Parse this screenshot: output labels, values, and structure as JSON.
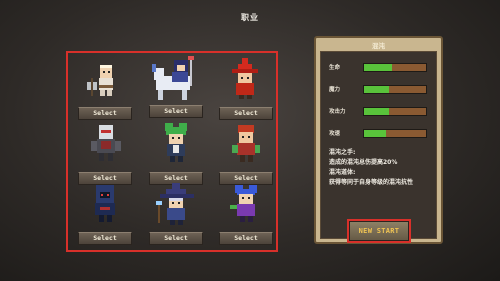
{
  "screen": {
    "title": "职业"
  },
  "characters": [
    {
      "name": "warrior",
      "select_label": "Select"
    },
    {
      "name": "knight-rider",
      "select_label": "Select"
    },
    {
      "name": "red-witch",
      "select_label": "Select"
    },
    {
      "name": "robot",
      "select_label": "Select"
    },
    {
      "name": "green-hair",
      "select_label": "Select"
    },
    {
      "name": "red-hair",
      "select_label": "Select"
    },
    {
      "name": "hooded-ninja",
      "select_label": "Select"
    },
    {
      "name": "wizard",
      "select_label": "Select"
    },
    {
      "name": "blue-hair",
      "select_label": "Select"
    }
  ],
  "panel": {
    "title": "混沌",
    "stats": [
      {
        "label": "生命",
        "level": 0.45
      },
      {
        "label": "魔力",
        "level": 0.4
      },
      {
        "label": "攻击力",
        "level": 0.4
      },
      {
        "label": "攻速",
        "level": 0.35
      }
    ],
    "description": [
      "混沌之手:",
      "造成的混沌总伤提高20%",
      "混沌道体:",
      "获得等同于自身等级的混沌抗性"
    ]
  },
  "start_button": {
    "label": "NEW START"
  },
  "colors": {
    "highlight": "#d8302a",
    "bar_fill": "#59c33b",
    "bar_empty": "#8a5a32",
    "panel": "#c9b68f",
    "start_text": "#f0c453"
  }
}
